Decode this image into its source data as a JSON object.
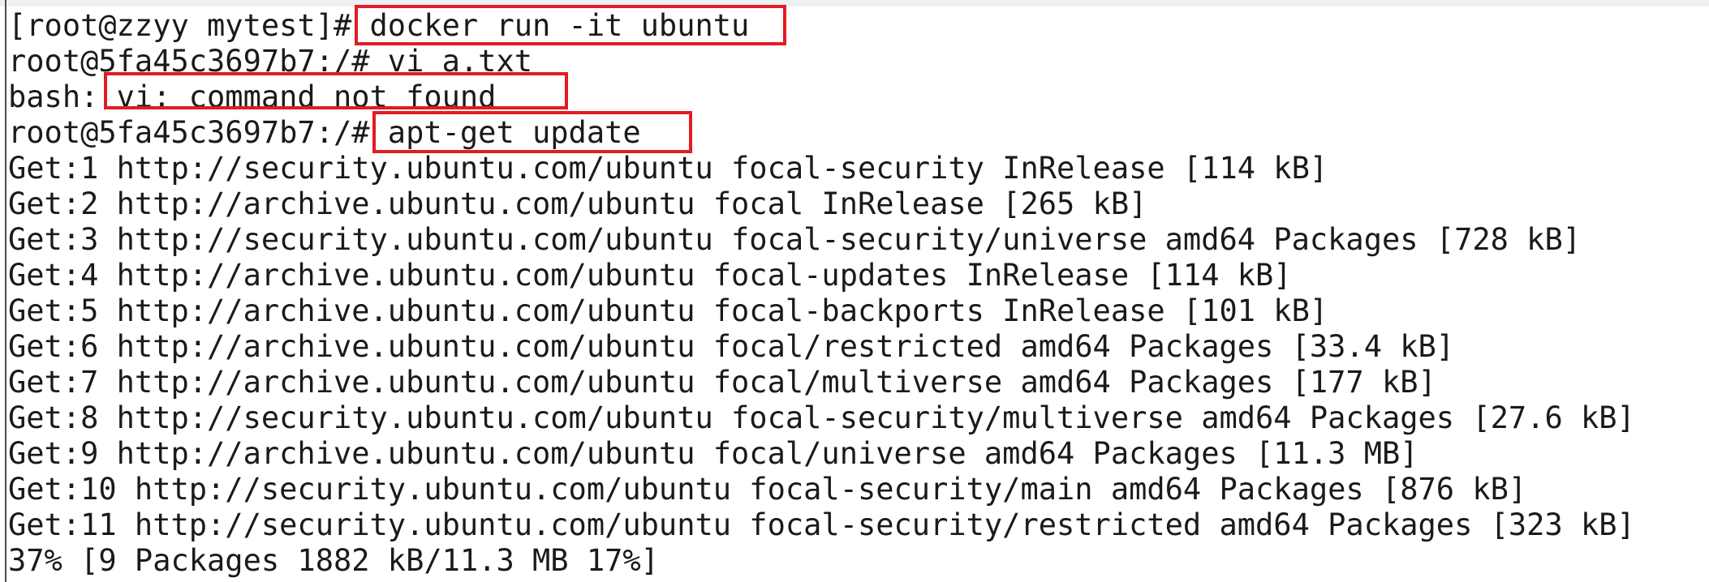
{
  "terminal": {
    "lines": [
      "[root@zzyy mytest]# docker run -it ubuntu",
      "root@5fa45c3697b7:/# vi a.txt",
      "bash: vi: command not found",
      "root@5fa45c3697b7:/# apt-get update",
      "Get:1 http://security.ubuntu.com/ubuntu focal-security InRelease [114 kB]",
      "Get:2 http://archive.ubuntu.com/ubuntu focal InRelease [265 kB]",
      "Get:3 http://security.ubuntu.com/ubuntu focal-security/universe amd64 Packages [728 kB]",
      "Get:4 http://archive.ubuntu.com/ubuntu focal-updates InRelease [114 kB]",
      "Get:5 http://archive.ubuntu.com/ubuntu focal-backports InRelease [101 kB]",
      "Get:6 http://archive.ubuntu.com/ubuntu focal/restricted amd64 Packages [33.4 kB]",
      "Get:7 http://archive.ubuntu.com/ubuntu focal/multiverse amd64 Packages [177 kB]",
      "Get:8 http://security.ubuntu.com/ubuntu focal-security/multiverse amd64 Packages [27.6 kB]",
      "Get:9 http://archive.ubuntu.com/ubuntu focal/universe amd64 Packages [11.3 MB]",
      "Get:10 http://security.ubuntu.com/ubuntu focal-security/main amd64 Packages [876 kB]",
      "Get:11 http://security.ubuntu.com/ubuntu focal-security/restricted amd64 Packages [323 kB]",
      "37% [9 Packages 1882 kB/11.3 MB 17%]"
    ]
  },
  "colors": {
    "text": "#1a1a1a",
    "background": "#ffffff",
    "highlight": "#e31b23"
  }
}
